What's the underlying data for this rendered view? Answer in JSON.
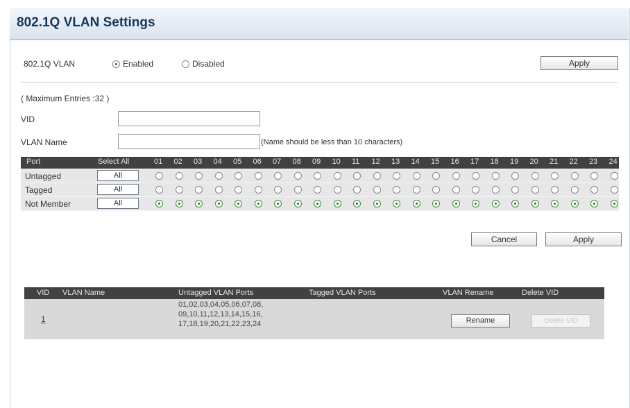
{
  "title": "802.1Q VLAN Settings",
  "vlan_toggle": {
    "label": "802.1Q VLAN",
    "enabled_label": "Enabled",
    "disabled_label": "Disabled",
    "selected": "Enabled"
  },
  "apply_top": "Apply",
  "max_entries": "( Maximum Entries :32 )",
  "vid_label": "VID",
  "vid_value": "",
  "vlan_name_label": "VLAN Name",
  "vlan_name_value": "",
  "vlan_name_hint": "(Name should be less than 10 characters)",
  "port_grid": {
    "port_header": "Port",
    "select_all_header": "Select All",
    "ports": [
      "01",
      "02",
      "03",
      "04",
      "05",
      "06",
      "07",
      "08",
      "09",
      "10",
      "11",
      "12",
      "13",
      "14",
      "15",
      "16",
      "17",
      "18",
      "19",
      "20",
      "21",
      "22",
      "23",
      "24"
    ],
    "rows": [
      {
        "label": "Untagged",
        "all_label": "All",
        "selected": false
      },
      {
        "label": "Tagged",
        "all_label": "All",
        "selected": false
      },
      {
        "label": "Not Member",
        "all_label": "All",
        "selected": true
      }
    ]
  },
  "cancel_label": "Cancel",
  "apply_bottom": "Apply",
  "vlan_table": {
    "headers": [
      "VID",
      "VLAN Name",
      "Untagged VLAN Ports",
      "Tagged VLAN Ports",
      "VLAN Rename",
      "Delete VID"
    ],
    "rows": [
      {
        "vid": "1",
        "vlan_name": "",
        "untagged_lines": [
          "01,02,03,04,05,06,07,08,",
          "09,10,11,12,13,14,15,16,",
          "17,18,19,20,21,22,23,24"
        ],
        "tagged": "",
        "rename_label": "Rename",
        "delete_label": "Delete VID"
      }
    ]
  },
  "colors": {
    "title_text": "#17365d",
    "grid_header": "#414141",
    "radio_selected": "#2b6e2b"
  }
}
